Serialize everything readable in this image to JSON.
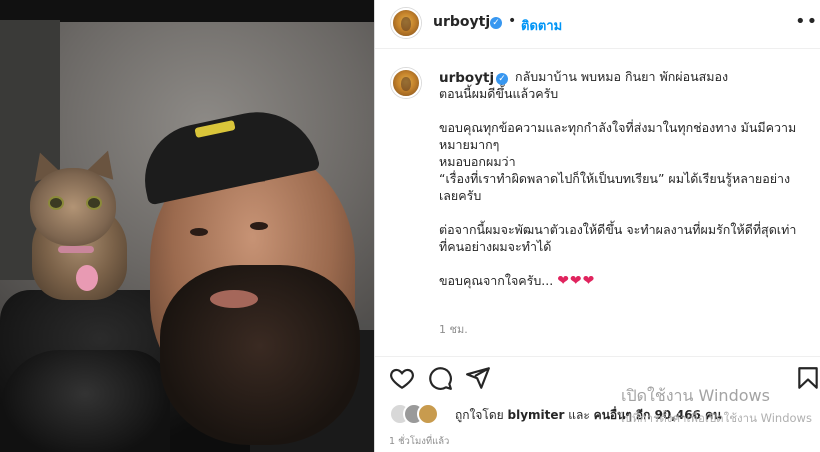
{
  "post": {
    "username": "urboytj",
    "verified_mark": "✓",
    "separator": "•",
    "follow_label": "ติดตาม",
    "more_label": "•••"
  },
  "caption": {
    "username": "urboytj",
    "lines": [
      "กลับมาบ้าน พบหมอ กินยา พักผ่อนสมอง",
      "ตอนนี้ผมดีขึ้นแล้วครับ",
      "",
      "ขอบคุณทุกข้อความและทุกกำลังใจที่ส่งมาในทุกช่องทาง มันมีความ",
      "หมายมากๆ",
      "หมอบอกผมว่า",
      "“เรื่องที่เราทำผิดพลาดไปก็ให้เป็นบทเรียน” ผมได้เรียนรู้หลายอย่าง",
      "เลยครับ",
      "",
      "ต่อจากนี้ผมจะพัฒนาตัวเองให้ดีขึ้น จะทำผลงานที่ผมรักให้ดีที่สุดเท่า",
      "ที่คนอย่างผมจะทำได้",
      "",
      "ขอบคุณจากใจครับ..."
    ],
    "hearts": "❤❤❤",
    "time_ago": "1 ชม."
  },
  "actions": {
    "like_icon": "heart-outline-icon",
    "comment_icon": "comment-icon",
    "share_icon": "paper-plane-icon",
    "save_icon": "bookmark-icon"
  },
  "likes": {
    "prefix": "ถูกใจโดย",
    "user": "blymiter",
    "middle": "และ",
    "others": "คนอื่นๆ อีก 90,466 คน"
  },
  "posted": "1 ชั่วโมงที่แล้ว",
  "watermark": {
    "line1": "เปิดใช้งาน Windows",
    "line2": "ไปที่การตั้งค่าเพื่อเปิดใช้งาน Windows"
  },
  "colors": {
    "accent": "#0095f6",
    "verified": "#3897f0",
    "heart": "#e0245e",
    "muted": "#8e8e8e"
  }
}
